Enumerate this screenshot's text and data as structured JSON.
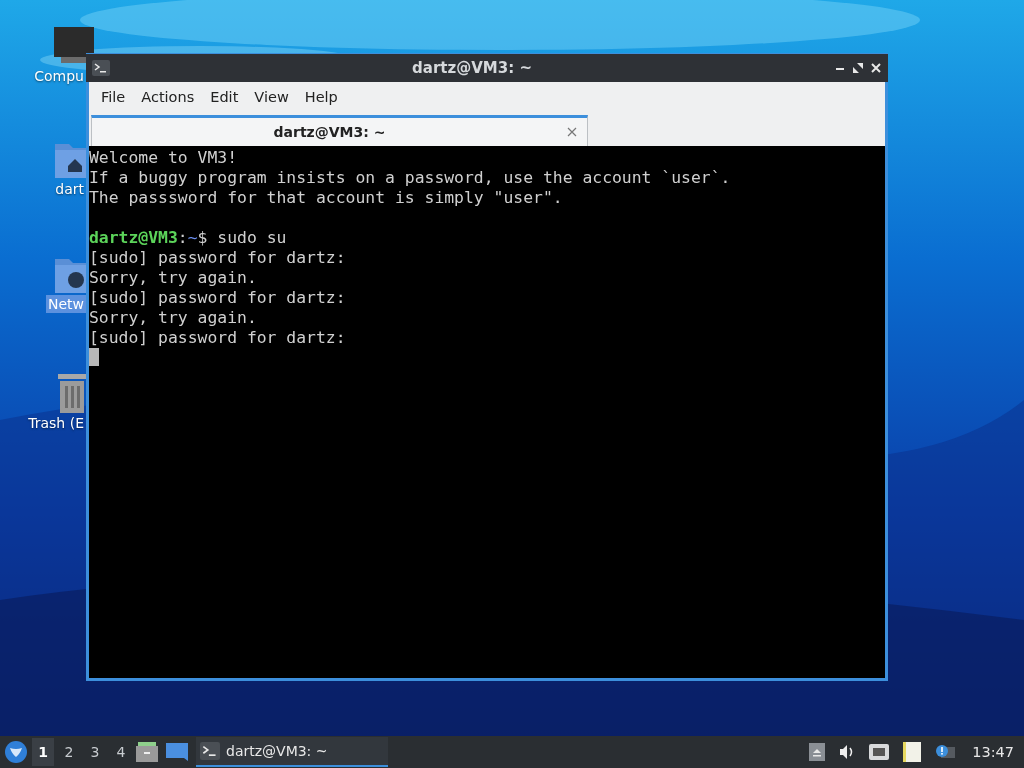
{
  "desktop_icons": [
    {
      "kind": "computer",
      "label": "Compu",
      "selected": false
    },
    {
      "kind": "home",
      "label": "dart",
      "selected": false
    },
    {
      "kind": "network",
      "label": "Netw",
      "selected": true
    },
    {
      "kind": "trash",
      "label": "Trash (E",
      "selected": false
    }
  ],
  "window": {
    "title": "dartz@VM3: ~",
    "menu": [
      "File",
      "Actions",
      "Edit",
      "View",
      "Help"
    ],
    "tabs": [
      {
        "label": "dartz@VM3: ~",
        "selected": true
      }
    ],
    "terminal": {
      "cursor_visible": true,
      "lines": [
        {
          "kind": "text",
          "text": "Welcome to VM3!"
        },
        {
          "kind": "text",
          "text": "If a buggy program insists on a password, use the account `user`."
        },
        {
          "kind": "text",
          "text": "The passsword for that account is simply \"user\"."
        },
        {
          "kind": "blank"
        },
        {
          "kind": "prompt",
          "user": "dartz@VM3",
          "separator": ":",
          "path": "~",
          "command": "$ sudo su"
        },
        {
          "kind": "text",
          "text": "[sudo] password for dartz:"
        },
        {
          "kind": "text",
          "text": "Sorry, try again."
        },
        {
          "kind": "text",
          "text": "[sudo] password for dartz:"
        },
        {
          "kind": "text",
          "text": "Sorry, try again."
        },
        {
          "kind": "text",
          "text": "[sudo] password for dartz:"
        }
      ]
    }
  },
  "taskbar": {
    "workspaces": [
      {
        "label": "1",
        "selected": true
      },
      {
        "label": "2",
        "selected": false
      },
      {
        "label": "3",
        "selected": false
      },
      {
        "label": "4",
        "selected": false
      }
    ],
    "tasks": [
      {
        "label": "dartz@VM3: ~",
        "selected": true
      }
    ],
    "clock": "13:47"
  }
}
